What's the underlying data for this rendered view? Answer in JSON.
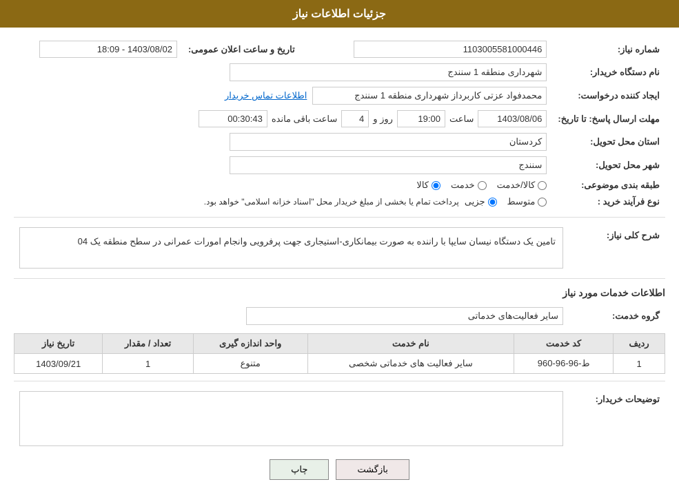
{
  "page": {
    "title": "جزئیات اطلاعات نیاز"
  },
  "header": {
    "need_number_label": "شماره نیاز:",
    "need_number_value": "1103005581000446",
    "buyer_org_label": "نام دستگاه خریدار:",
    "buyer_org_value": "شهرداری منطقه 1 سنندج",
    "creator_label": "ایجاد کننده درخواست:",
    "creator_value": "محمدفواد عزتی کاربرداز شهرداری منطقه 1 سنندج",
    "contact_link": "اطلاعات تماس خریدار",
    "date_label": "تاریخ و ساعت اعلان عمومی:",
    "date_value": "1403/08/02 - 18:09",
    "deadline_label": "مهلت ارسال پاسخ: تا تاریخ:",
    "deadline_date": "1403/08/06",
    "deadline_time_label": "ساعت",
    "deadline_time": "19:00",
    "deadline_days_label": "روز و",
    "deadline_days": "4",
    "remaining_label": "ساعت باقی مانده",
    "remaining_time": "00:30:43",
    "province_label": "استان محل تحویل:",
    "province_value": "کردستان",
    "city_label": "شهر محل تحویل:",
    "city_value": "سنندج",
    "category_label": "طبقه بندی موضوعی:",
    "category_options": [
      {
        "label": "کالا",
        "name": "cat",
        "value": "kala"
      },
      {
        "label": "خدمت",
        "name": "cat",
        "value": "khedmat"
      },
      {
        "label": "کالا/خدمت",
        "name": "cat",
        "value": "kala_khedmat"
      }
    ],
    "purchase_type_label": "نوع فرآیند خرید :",
    "purchase_type_options": [
      {
        "label": "جزیی",
        "name": "ptype",
        "value": "jozi"
      },
      {
        "label": "متوسط",
        "name": "ptype",
        "value": "motavasset"
      }
    ],
    "purchase_notice": "پرداخت تمام یا بخشی از مبلغ خریدار محل \"اسناد خزانه اسلامی\" خواهد بود."
  },
  "description": {
    "section_title": "شرح کلی نیاز:",
    "text": "تامین یک دستگاه نیسان سایپا با راننده به صورت بیمانکاری-استیجاری جهت پرفرویی وانجام امورات عمرانی در سطح منطقه یک 04"
  },
  "services_section": {
    "title": "اطلاعات خدمات مورد نیاز",
    "group_label": "گروه خدمت:",
    "group_value": "سایر فعالیت‌های خدماتی",
    "table": {
      "headers": [
        "ردیف",
        "کد خدمت",
        "نام خدمت",
        "واحد اندازه گیری",
        "تعداد / مقدار",
        "تاریخ نیاز"
      ],
      "rows": [
        {
          "row_num": "1",
          "service_code": "ط-96-96-960",
          "service_name": "سایر فعالیت های خدماتی شخصی",
          "unit": "متنوع",
          "quantity": "1",
          "date": "1403/09/21"
        }
      ]
    }
  },
  "buyer_notes": {
    "label": "توضیحات خریدار:",
    "value": ""
  },
  "buttons": {
    "print": "چاپ",
    "back": "بازگشت"
  }
}
